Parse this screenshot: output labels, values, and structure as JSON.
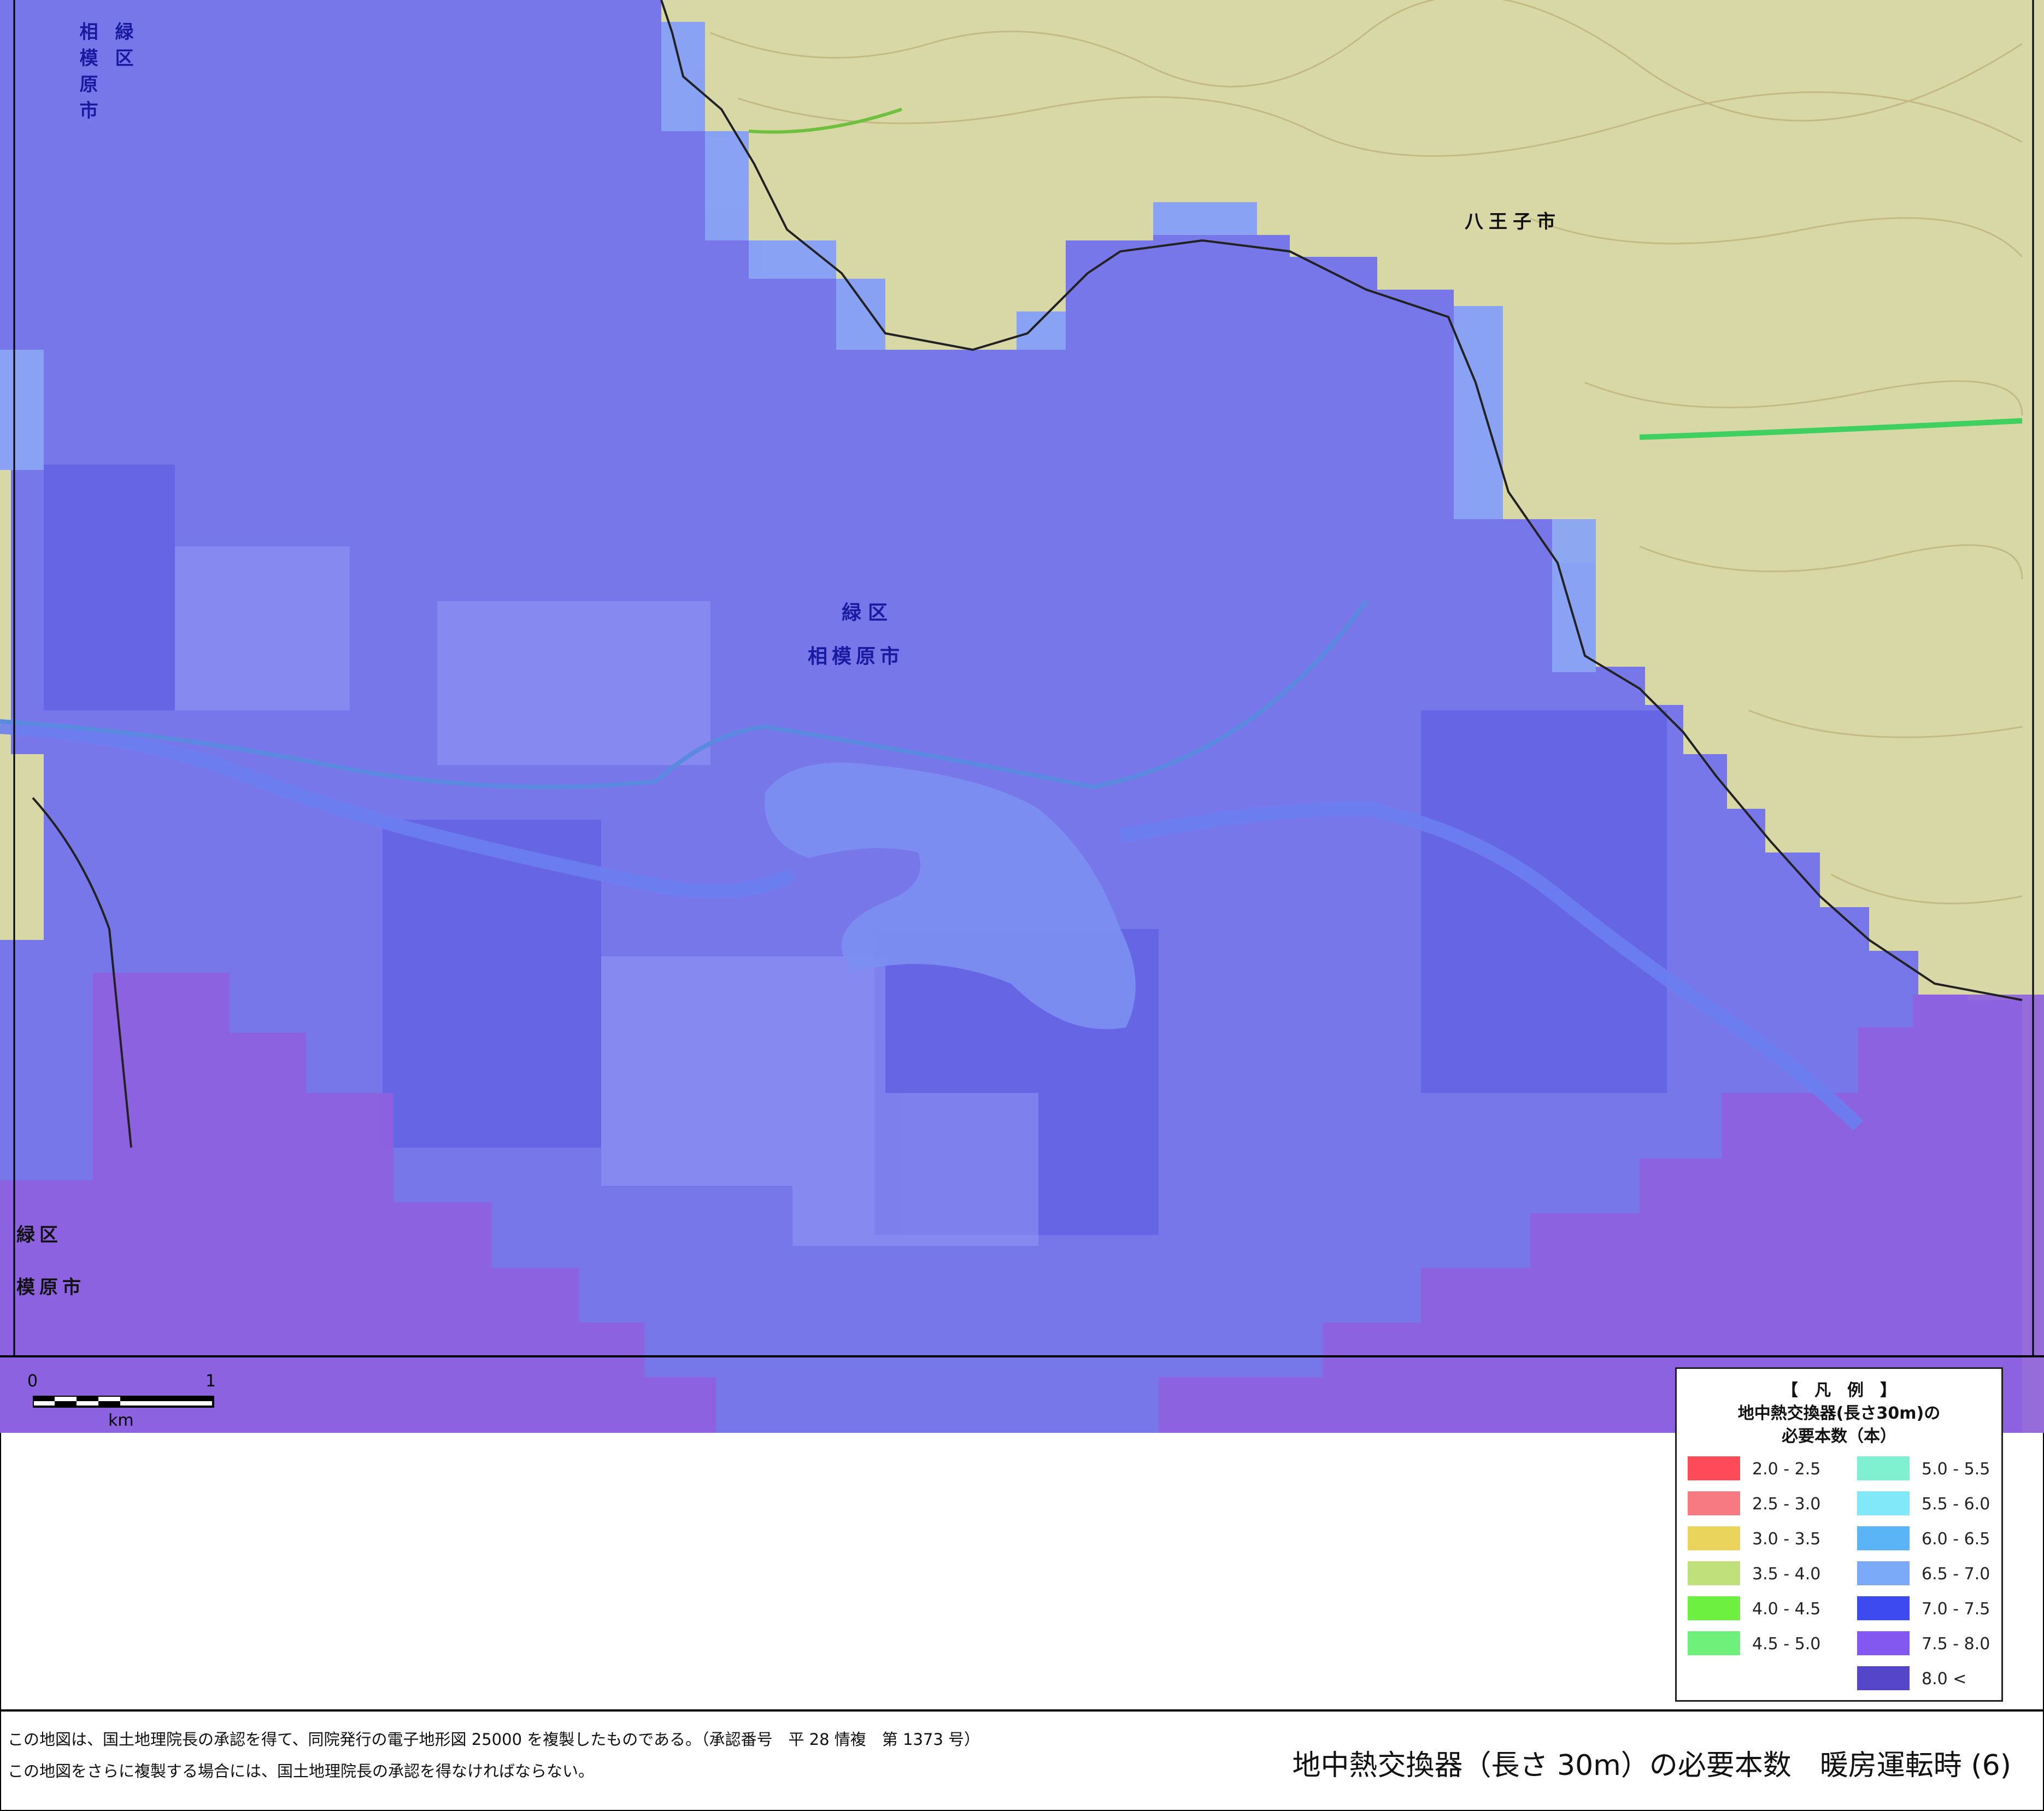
{
  "map": {
    "labels": {
      "midori_ku_top_left": "緑区",
      "sagamihara_top_left": "相模原市",
      "midori_ku_center": "緑区",
      "sagamihara_center": "相模原市",
      "hachioji": "八王子市",
      "midori_ku_bottom_left": "緑区",
      "sagamihara_bottom_left": "模原市"
    },
    "scale": {
      "zero": "0",
      "one": "1",
      "unit": "km"
    },
    "colors": {
      "land": "#d8d8a6",
      "blue_overlay": "#6f6ff0",
      "purple_overlay": "#8f5fe0",
      "lake": "#7b8ef0",
      "light_cells": "#8aa4f4"
    }
  },
  "legend": {
    "header": "【　凡　例　】",
    "title_line1": "地中熱交換器(長さ30m)の",
    "title_line2": "必要本数（本）",
    "items": [
      {
        "label": "2.0  -  2.5",
        "color": "#ff4a5a"
      },
      {
        "label": "2.5  -  3.0",
        "color": "#f77a82"
      },
      {
        "label": "3.0  -  3.5",
        "color": "#ead45c"
      },
      {
        "label": "3.5  -  4.0",
        "color": "#bfe07a"
      },
      {
        "label": "4.0  -  4.5",
        "color": "#6ef040"
      },
      {
        "label": "4.5  -  5.0",
        "color": "#6ff07a"
      },
      {
        "label": "5.0  -  5.5",
        "color": "#7ff0d0"
      },
      {
        "label": "5.5  -  6.0",
        "color": "#80e8f8"
      },
      {
        "label": "6.0  -  6.5",
        "color": "#5ab4f6"
      },
      {
        "label": "6.5  -  7.0",
        "color": "#7aaaf8"
      },
      {
        "label": "7.0  -  7.5",
        "color": "#3c4af0"
      },
      {
        "label": "7.5  -  8.0",
        "color": "#8258f0"
      },
      {
        "label": "8.0  <",
        "color": "#5545c8"
      }
    ]
  },
  "footer": {
    "note_line1": "この地図は、国土地理院長の承認を得て、同院発行の電子地形図 25000 を複製したものである。（承認番号　平 28 情複　第 1373 号）",
    "note_line2": "この地図をさらに複製する場合には、国土地理院長の承認を得なければならない。",
    "caption": "地中熱交換器（長さ 30m）の必要本数　暖房運転時 (6)"
  }
}
